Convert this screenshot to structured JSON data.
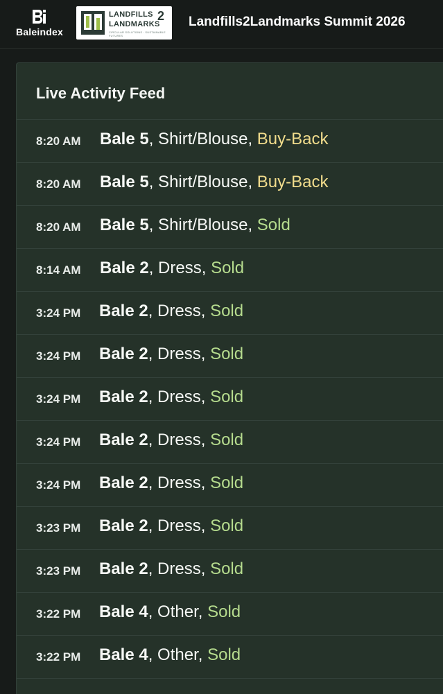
{
  "header": {
    "brand_name": "Baleindex",
    "brand_mark_text": "Bi",
    "partner_logo": {
      "line1": "LANDFILLS",
      "number": "2",
      "line2": "LANDMARKS",
      "tagline": "CIRCULAR SOLUTIONS · SUSTAINABLE FUTURES"
    },
    "event_title": "Landfills2Landmarks Summit 2026"
  },
  "feed": {
    "heading": "Live Activity Feed",
    "items": [
      {
        "time": "8:20 AM",
        "bale": "Bale 5",
        "item": ", Shirt/Blouse, ",
        "status": "Buy-Back",
        "status_type": "buyback"
      },
      {
        "time": "8:20 AM",
        "bale": "Bale 5",
        "item": ", Shirt/Blouse, ",
        "status": "Buy-Back",
        "status_type": "buyback"
      },
      {
        "time": "8:20 AM",
        "bale": "Bale 5",
        "item": ", Shirt/Blouse, ",
        "status": "Sold",
        "status_type": "sold"
      },
      {
        "time": "8:14 AM",
        "bale": "Bale 2",
        "item": ", Dress, ",
        "status": "Sold",
        "status_type": "sold"
      },
      {
        "time": "3:24 PM",
        "bale": "Bale 2",
        "item": ", Dress, ",
        "status": "Sold",
        "status_type": "sold"
      },
      {
        "time": "3:24 PM",
        "bale": "Bale 2",
        "item": ", Dress, ",
        "status": "Sold",
        "status_type": "sold"
      },
      {
        "time": "3:24 PM",
        "bale": "Bale 2",
        "item": ", Dress, ",
        "status": "Sold",
        "status_type": "sold"
      },
      {
        "time": "3:24 PM",
        "bale": "Bale 2",
        "item": ", Dress, ",
        "status": "Sold",
        "status_type": "sold"
      },
      {
        "time": "3:24 PM",
        "bale": "Bale 2",
        "item": ", Dress, ",
        "status": "Sold",
        "status_type": "sold"
      },
      {
        "time": "3:23 PM",
        "bale": "Bale 2",
        "item": ", Dress, ",
        "status": "Sold",
        "status_type": "sold"
      },
      {
        "time": "3:23 PM",
        "bale": "Bale 2",
        "item": ", Dress, ",
        "status": "Sold",
        "status_type": "sold"
      },
      {
        "time": "3:22 PM",
        "bale": "Bale 4",
        "item": ", Other, ",
        "status": "Sold",
        "status_type": "sold"
      },
      {
        "time": "3:22 PM",
        "bale": "Bale 4",
        "item": ", Other, ",
        "status": "Sold",
        "status_type": "sold"
      }
    ]
  },
  "colors": {
    "page_background": "#171b19",
    "panel_background": "#253229",
    "divider": "#33413a",
    "status_buyback": "#f1dc8c",
    "status_sold": "#b6dc8e",
    "partner_logo_green": "#2b3a35"
  },
  "icons": {
    "brand": "baleindex-logo-icon",
    "partner": "landfills2landmarks-logo-icon"
  }
}
